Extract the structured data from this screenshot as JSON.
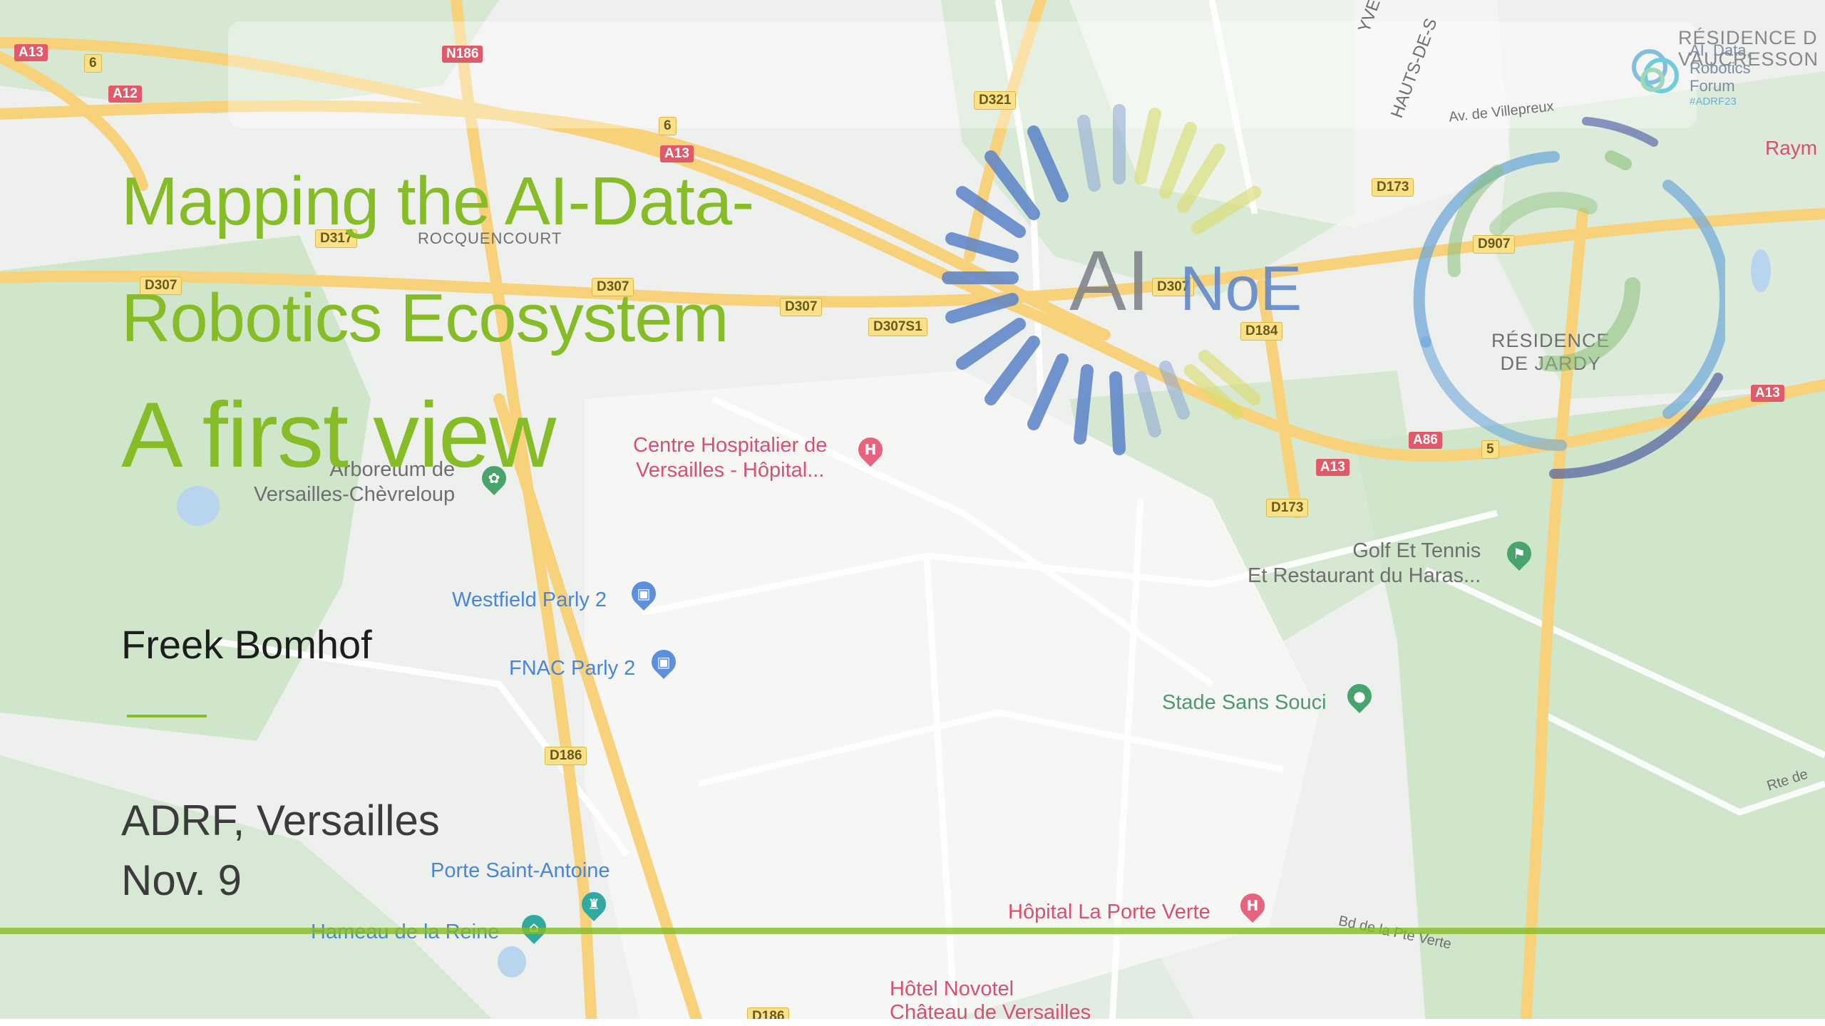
{
  "slide": {
    "title_line1": "Mapping the AI-Data-",
    "title_line2": "Robotics Ecosystem",
    "subtitle": "A first view",
    "author": "Freek Bomhof",
    "venue_line1": "ADRF, Versailles",
    "venue_line2": "Nov. 9"
  },
  "ainoe_logo": {
    "ai": "AI",
    "noe": "NoE"
  },
  "adrf_logo": {
    "line1": "AI, Data,",
    "line2": "Robotics",
    "line3": "Forum",
    "tag": "#ADRF23"
  },
  "map": {
    "places": {
      "rocquencourt": "ROCQUENCOURT",
      "residence_jardy_1": "RÉSIDENCE",
      "residence_jardy_2": "DE JARDY",
      "residence_top_1": "RÉSIDENCE D",
      "residence_top_2": "VAUCRESSON",
      "yvelines": "YVELI",
      "hauts_de_seine": "HAUTS-DE-S",
      "av_villepreux": "Av. de Villepreux",
      "raym": "Raym",
      "bd_pte_verte": "Bd de la Pte Verte",
      "rte_de": "Rte de"
    },
    "pois": {
      "hospital_1": "Centre Hospitalier de",
      "hospital_2": "Versailles - Hôpital...",
      "arboretum_1": "Arboretum de",
      "arboretum_2": "Versailles-Chèvreloup",
      "westfield": "Westfield Parly 2",
      "fnac": "FNAC Parly 2",
      "golf_1": "Golf Et Tennis",
      "golf_2": "Et Restaurant du Haras...",
      "stade": "Stade Sans Souci",
      "porte": "Porte Saint-Antoine",
      "hameau": "Hameau de la Reine",
      "hopital_verte": "Hôpital La Porte Verte",
      "novotel_1": "Hôtel Novotel",
      "novotel_2": "Château de Versailles"
    },
    "roads": {
      "a13_a": "A13",
      "a13_b": "A13",
      "a13_c": "A13",
      "a13_d": "A13",
      "a12": "A12",
      "n186": "N186",
      "a86": "A86",
      "d321": "D321",
      "d317": "D317",
      "d307_a": "D307",
      "d307_b": "D307",
      "d307_c": "D307",
      "d307_d": "D307",
      "d307s1": "D307S1",
      "d184": "D184",
      "d173_a": "D173",
      "d173_b": "D173",
      "d907": "D907",
      "d186_a": "D186",
      "d186_b": "D186",
      "n6_a": "6",
      "n6_b": "6",
      "n5": "5"
    }
  },
  "colors": {
    "accent_green": "#86bc25",
    "road_yellow": "#f7d27a",
    "map_green": "#c9e3c4",
    "map_bg": "#eef0ee"
  }
}
